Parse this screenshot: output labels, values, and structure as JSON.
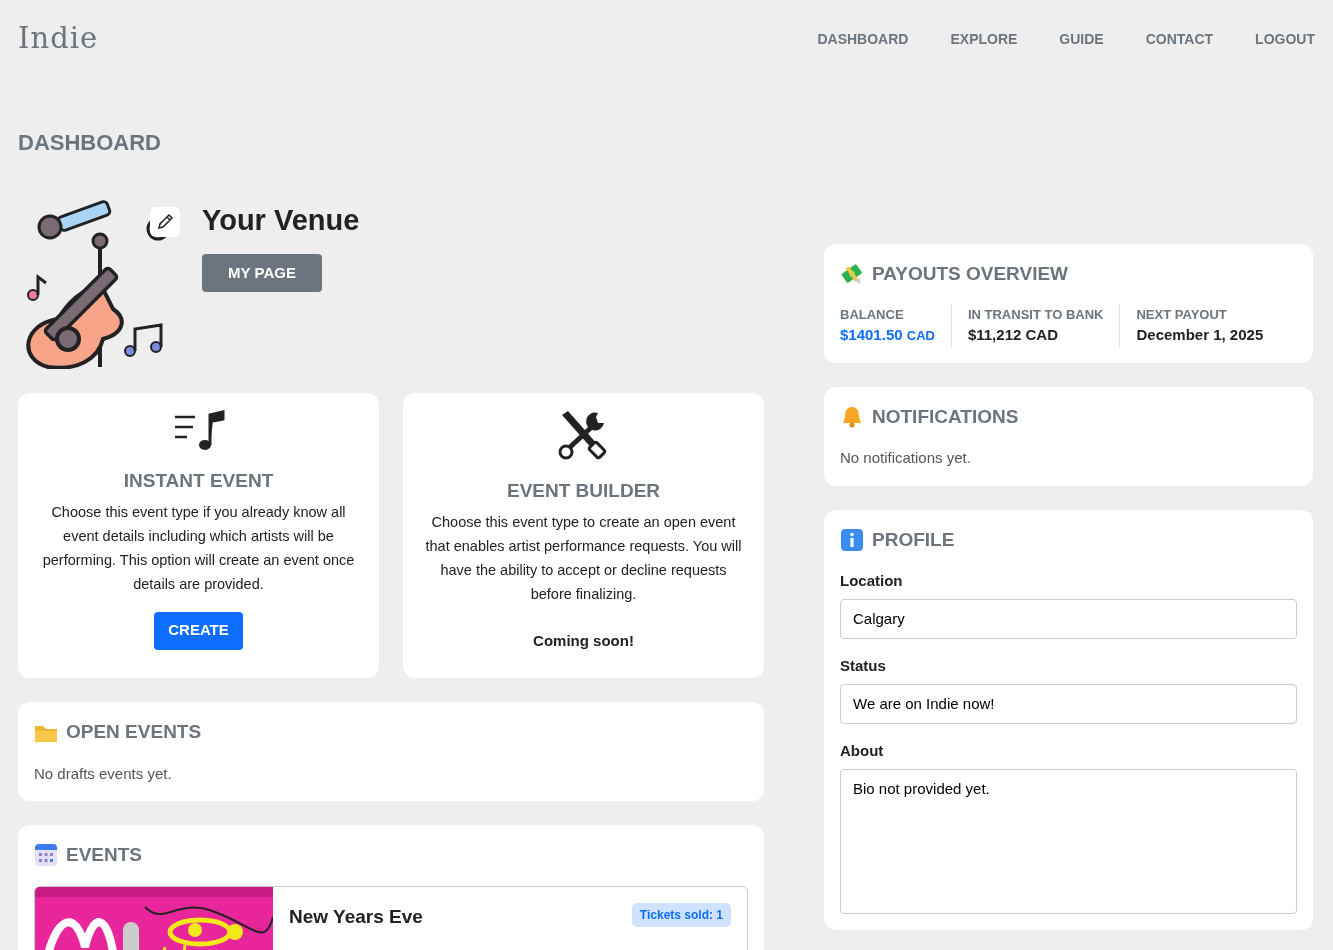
{
  "brand": "Indie",
  "nav": [
    {
      "label": "DASHBOARD"
    },
    {
      "label": "EXPLORE"
    },
    {
      "label": "GUIDE"
    },
    {
      "label": "CONTACT"
    },
    {
      "label": "LOGOUT"
    }
  ],
  "page_title": "DASHBOARD",
  "venue": {
    "name": "Your Venue",
    "button": "MY PAGE"
  },
  "event_types": [
    {
      "kind": "instant",
      "title": "INSTANT EVENT",
      "description": "Choose this event type if you already know all event details including which artists will be performing. This option will create an event once details are provided.",
      "action": {
        "kind": "button",
        "label": "CREATE"
      }
    },
    {
      "kind": "builder",
      "title": "EVENT BUILDER",
      "description": "Choose this event type to create an open event that enables artist performance requests. You will have the ability to accept or decline requests before finalizing.",
      "action": {
        "kind": "note",
        "label": "Coming soon!"
      }
    }
  ],
  "open_events": {
    "title": "OPEN EVENTS",
    "empty": "No drafts events yet."
  },
  "events": {
    "title": "EVENTS",
    "items": [
      {
        "kind": "picture",
        "title": "New Years Eve",
        "badge": "Tickets sold: 1"
      }
    ]
  },
  "payouts": {
    "title": "PAYOUTS OVERVIEW",
    "stats": [
      {
        "label": "BALANCE",
        "value": "$1401.50",
        "unit": "CAD",
        "highlight": true
      },
      {
        "label": "IN TRANSIT TO BANK",
        "value": "$11,212 CAD",
        "highlight": false
      },
      {
        "label": "NEXT PAYOUT",
        "value": "December 1, 2025",
        "highlight": false
      }
    ]
  },
  "notifications": {
    "title": "NOTIFICATIONS",
    "empty": "No notifications yet."
  },
  "profile": {
    "title": "PROFILE",
    "fields": [
      {
        "kind": "input",
        "label": "Location",
        "value": "Calgary"
      },
      {
        "kind": "input",
        "label": "Status",
        "value": "We are on Indie now!"
      },
      {
        "kind": "textarea",
        "label": "About",
        "value": "Bio not provided yet."
      }
    ]
  }
}
